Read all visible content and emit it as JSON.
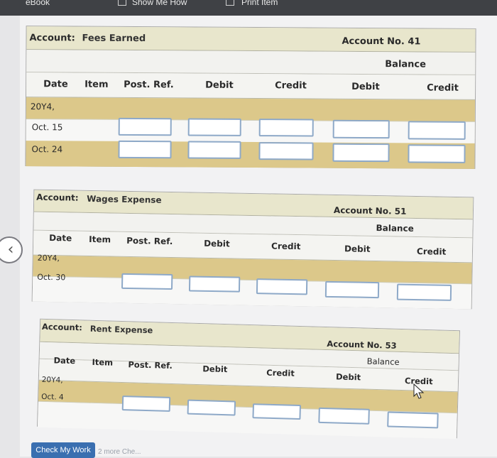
{
  "toolbar": {
    "ebook": "eBook",
    "show_me_how": "Show Me How",
    "print_item": "Print Item"
  },
  "ledgers": [
    {
      "account_label": "Account:",
      "account_name": "Fees Earned",
      "account_no": "Account No. 41",
      "balance": "Balance",
      "columns": [
        "Date",
        "Item",
        "Post. Ref.",
        "Debit",
        "Credit",
        "Debit",
        "Credit"
      ],
      "year": "20Y4,",
      "rows": [
        "Oct. 15",
        "Oct. 24"
      ]
    },
    {
      "account_label": "Account:",
      "account_name": "Wages Expense",
      "account_no": "Account No. 51",
      "balance": "Balance",
      "columns": [
        "Date",
        "Item",
        "Post. Ref.",
        "Debit",
        "Credit",
        "Debit",
        "Credit"
      ],
      "year": "20Y4,",
      "rows": [
        "Oct. 30"
      ]
    },
    {
      "account_label": "Account:",
      "account_name": "Rent Expense",
      "account_no": "Account No. 53",
      "balance": "Balance",
      "columns": [
        "Date",
        "Item",
        "Post. Ref.",
        "Debit",
        "Credit",
        "Debit",
        "Credit"
      ],
      "year": "20Y4,",
      "rows": [
        "Oct. 4"
      ]
    }
  ],
  "footer": {
    "check_my_work": "Check My Work",
    "more_note": "2 more Che..."
  }
}
